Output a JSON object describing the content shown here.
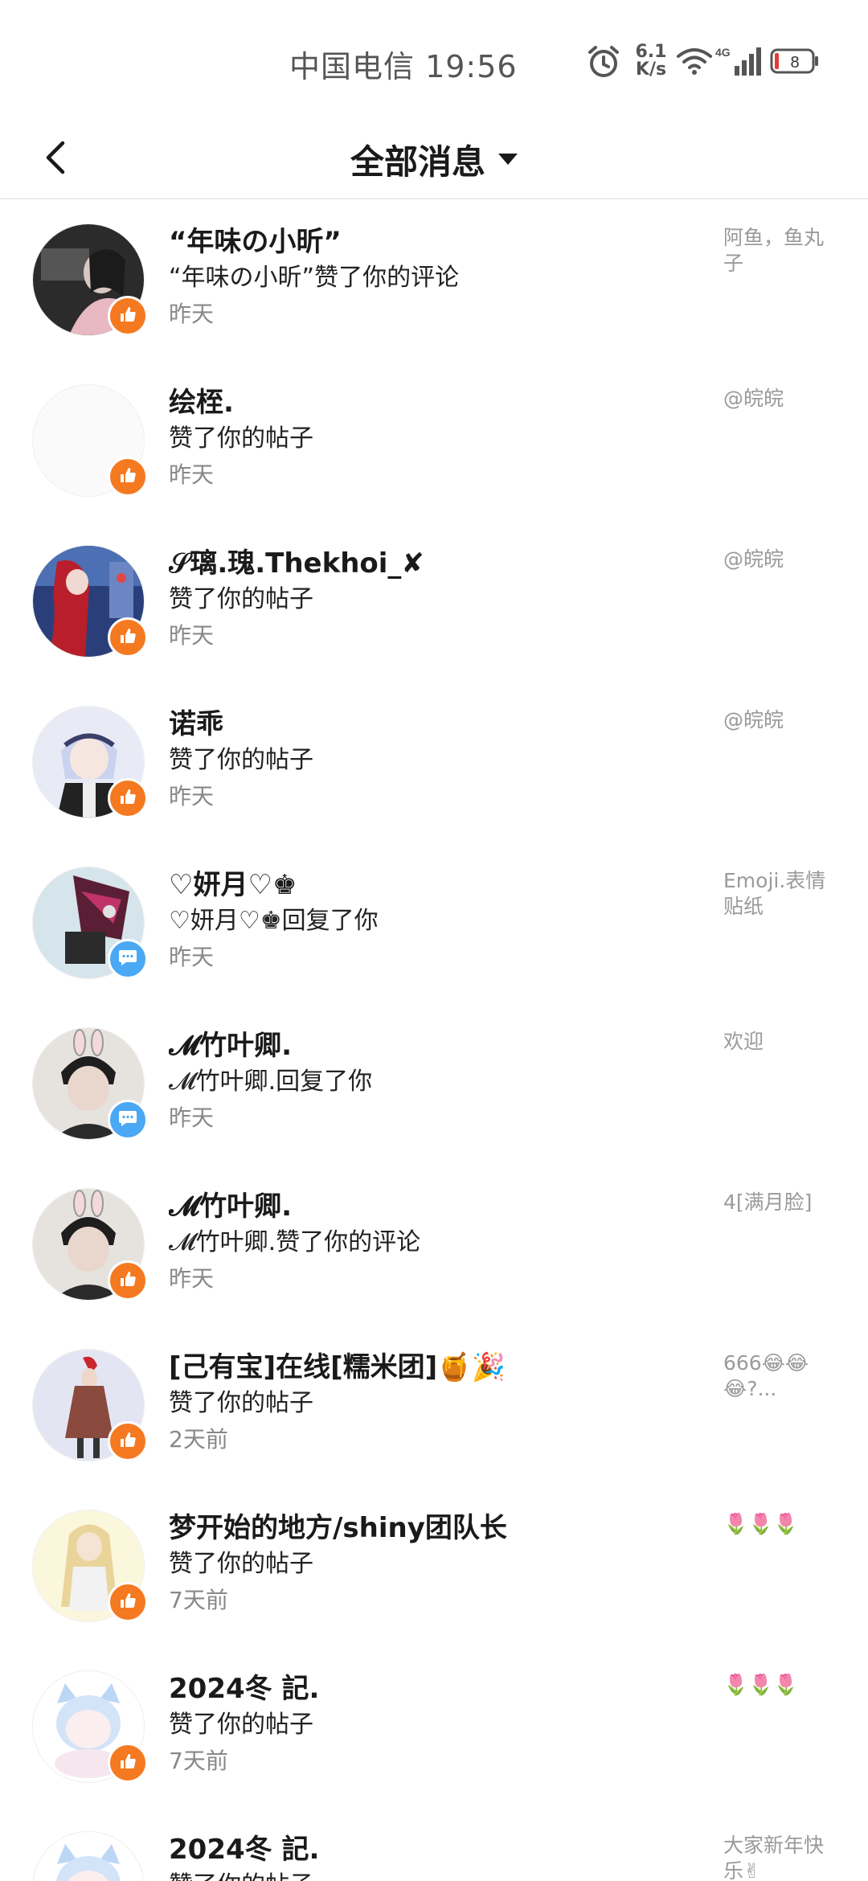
{
  "status_bar": {
    "carrier_time": "中国电信 19:56",
    "net_speed_value": "6.1",
    "net_speed_unit": "K/s",
    "network_type": "4G",
    "battery_level": "8"
  },
  "header": {
    "back_icon": "chevron-left-icon",
    "title": "全部消息",
    "dropdown_icon": "caret-down-icon"
  },
  "colors": {
    "like_badge": "#f57920",
    "reply_badge": "#4aa8f5",
    "battery_low": "#e53935"
  },
  "items": [
    {
      "name": "“年味の小昕”",
      "action": "“年味の小昕”赞了你的评论",
      "time": "昨天",
      "ref": "阿鱼，鱼丸子",
      "badge": "like-icon"
    },
    {
      "name": "绘桎.",
      "action": "赞了你的帖子",
      "time": "昨天",
      "ref": "@皖皖",
      "badge": "like-icon"
    },
    {
      "name": "𝒮璃.瑰.Thekhoi_✘",
      "action": "赞了你的帖子",
      "time": "昨天",
      "ref": "@皖皖",
      "badge": "like-icon"
    },
    {
      "name": "诺乖",
      "action": "赞了你的帖子",
      "time": "昨天",
      "ref": "@皖皖",
      "badge": "like-icon"
    },
    {
      "name": "♡妍月♡♚",
      "action": "♡妍月♡♚回复了你",
      "time": "昨天",
      "ref": "Emoji.表情贴纸",
      "badge": "reply-icon"
    },
    {
      "name": "𝓜竹叶卿.",
      "action": "𝓜竹叶卿.回复了你",
      "time": "昨天",
      "ref": "欢迎",
      "badge": "reply-icon"
    },
    {
      "name": "𝓜竹叶卿.",
      "action": "𝓜竹叶卿.赞了你的评论",
      "time": "昨天",
      "ref": "4[满月脸]",
      "badge": "like-icon"
    },
    {
      "name": "[己有宝]在线[糯米团]🍯🎉",
      "action": "赞了你的帖子",
      "time": "2天前",
      "ref": "666😂😂😂?...",
      "badge": "like-icon"
    },
    {
      "name": "梦开始的地方/shiny团队长",
      "action": "赞了你的帖子",
      "time": "7天前",
      "ref": "🌷🌷🌷",
      "badge": "like-icon"
    },
    {
      "name": "2024冬 記.",
      "action": "赞了你的帖子",
      "time": "7天前",
      "ref": "🌷🌷🌷",
      "badge": "like-icon"
    },
    {
      "name": "2024冬 記.",
      "action": "赞了你的帖子",
      "time": "",
      "ref": "大家新年快乐✌",
      "badge": "like-icon"
    }
  ]
}
